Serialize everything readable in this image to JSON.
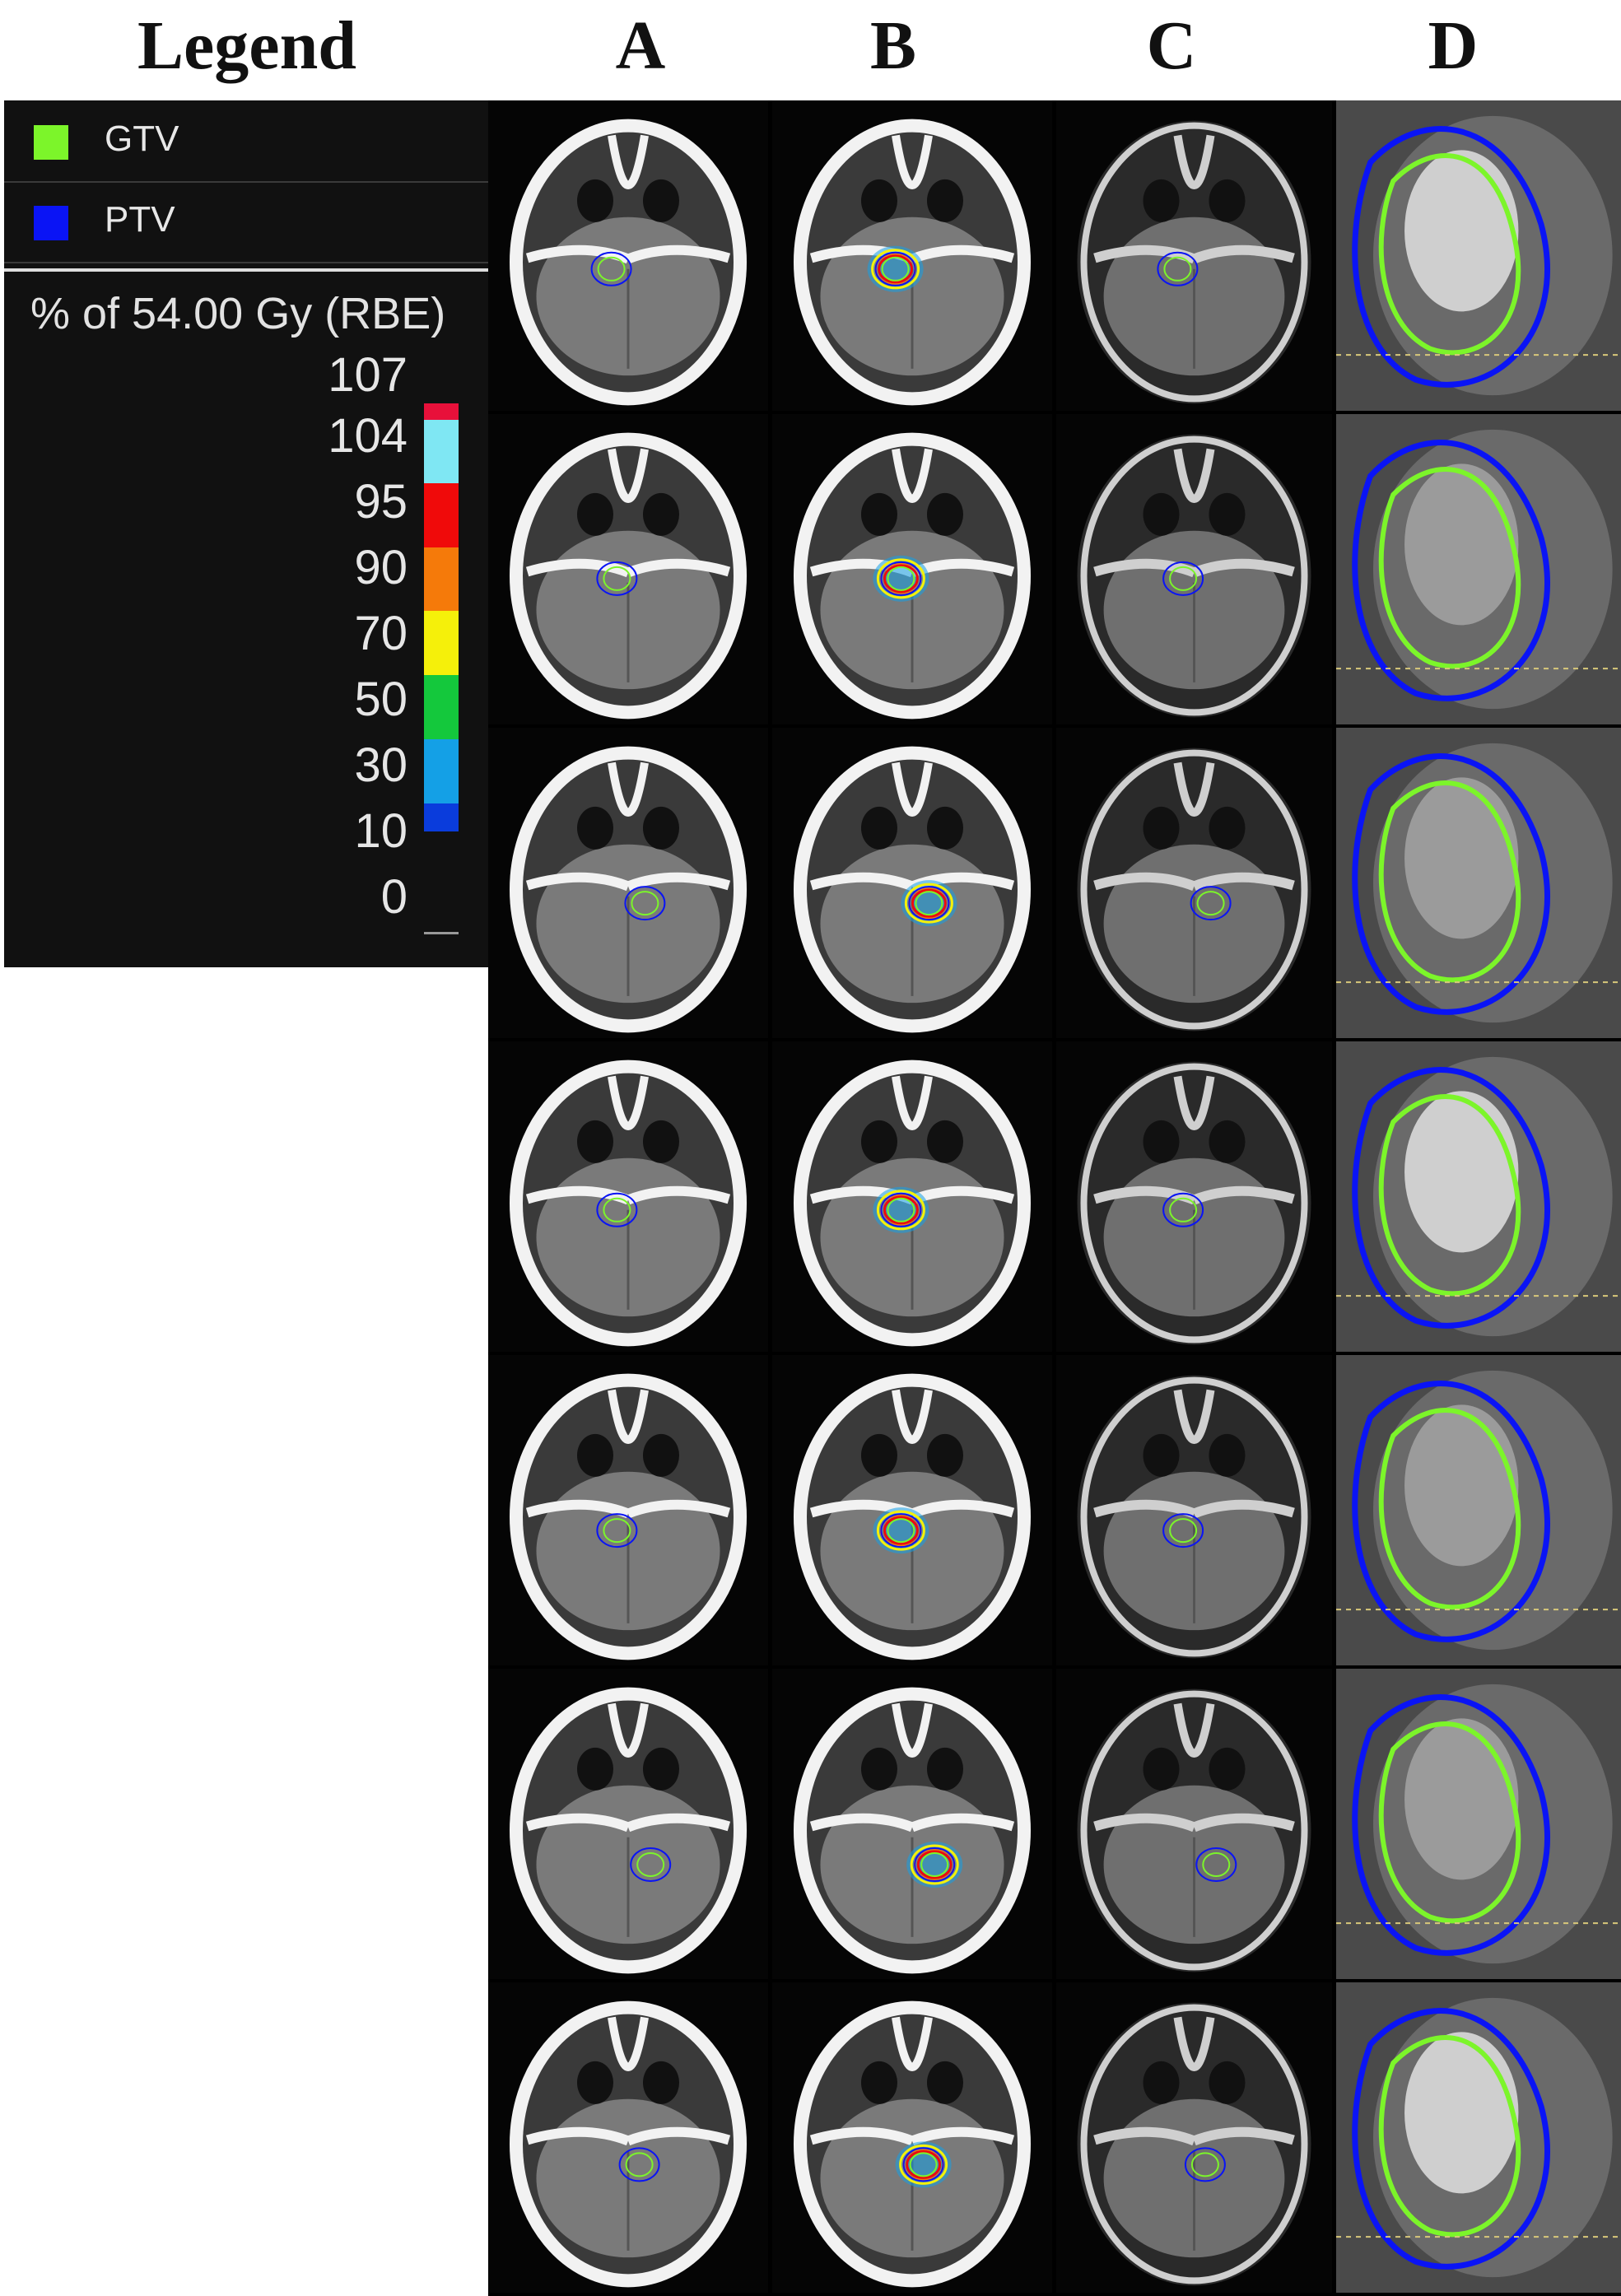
{
  "legend_heading": "Legend",
  "columns": [
    "A",
    "B",
    "C",
    "D"
  ],
  "structures": [
    {
      "name": "GTV",
      "color": "#7cf52a"
    },
    {
      "name": "PTV",
      "color": "#0a14f5"
    }
  ],
  "dose_title": "% of 54.00 Gy (RBE)",
  "dose_scale": [
    {
      "label": "107",
      "color": "#e8103a"
    },
    {
      "label": "104",
      "color": "#7fe7f3"
    },
    {
      "label": "95",
      "color": "#f00a0a"
    },
    {
      "label": "90",
      "color": "#f57a0a"
    },
    {
      "label": "70",
      "color": "#f5f00a"
    },
    {
      "label": "50",
      "color": "#14c83c"
    },
    {
      "label": "30",
      "color": "#14a0e6"
    },
    {
      "label": "10",
      "color": "#0a3cdc"
    },
    {
      "label": "0",
      "color": "#000000"
    }
  ],
  "rows": 7
}
